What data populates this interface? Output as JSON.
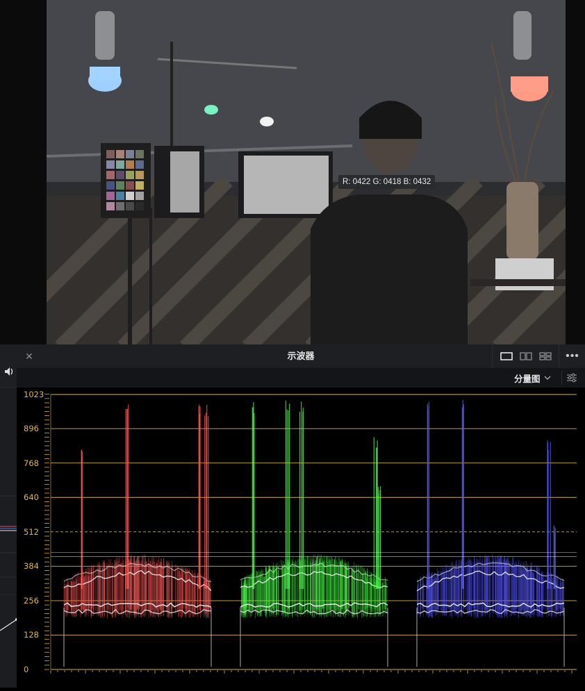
{
  "viewer": {
    "pixel_readout": "R: 0422 G: 0418 B: 0432"
  },
  "scope": {
    "title": "示波器",
    "close_icon": "close-icon",
    "mode_label": "分量图",
    "layout_icons": [
      "single-layout-icon",
      "dual-layout-icon",
      "quad-layout-icon"
    ],
    "more_icon": "more-dots-icon",
    "settings_icon": "sliders-icon"
  },
  "colors": {
    "graticule": "#d8b04a",
    "red_channel": "#ff5a5a",
    "green_channel": "#4cff4c",
    "blue_channel": "#5a5aff",
    "panel_bg": "#141518"
  },
  "chart_data": {
    "type": "parade_waveform",
    "channels": [
      "R",
      "G",
      "B"
    ],
    "y_ticks": [
      1023,
      896,
      768,
      640,
      512,
      384,
      256,
      128,
      0
    ],
    "ylim": [
      0,
      1023
    ],
    "reference_dashed": 512,
    "grid": true
  }
}
